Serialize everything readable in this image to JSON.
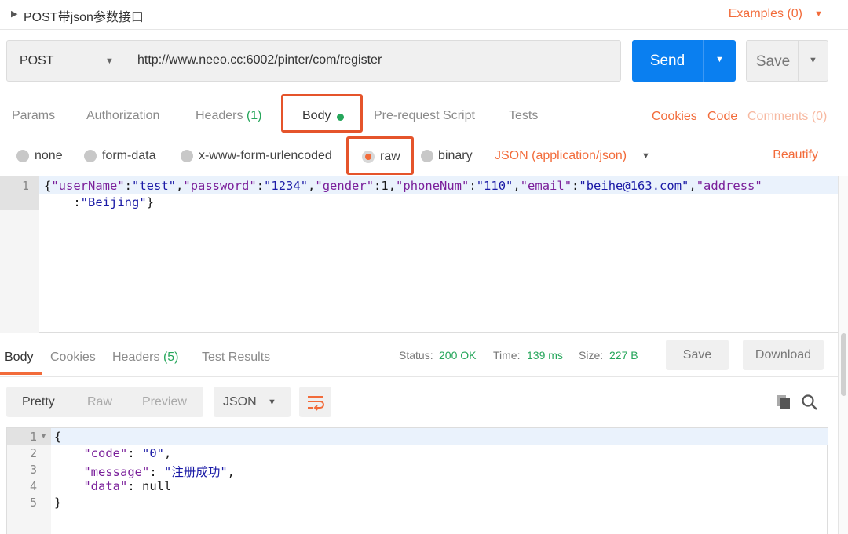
{
  "request": {
    "title": "POST带json参数接口",
    "examples_label": "Examples (0)",
    "method": "POST",
    "url": "http://www.neeo.cc:6002/pinter/com/register",
    "send_label": "Send",
    "save_label": "Save"
  },
  "request_tabs": {
    "params": "Params",
    "authorization": "Authorization",
    "headers": "Headers",
    "headers_count": "(1)",
    "body": "Body",
    "prerequest": "Pre-request Script",
    "tests": "Tests",
    "cookies": "Cookies",
    "code": "Code",
    "comments": "Comments (0)"
  },
  "body_types": {
    "none": "none",
    "form_data": "form-data",
    "urlencoded": "x-www-form-urlencoded",
    "raw": "raw",
    "binary": "binary",
    "selected": "raw",
    "content_type": "JSON (application/json)",
    "beautify": "Beautify"
  },
  "request_editor": {
    "line_number": "1",
    "line1": {
      "t1": "{",
      "t2": "\"userName\"",
      "t3": ":",
      "t4": "\"test\"",
      "t5": ",",
      "t6": "\"password\"",
      "t7": ":",
      "t8": "\"1234\"",
      "t9": ",",
      "t10": "\"gender\"",
      "t11": ":1,",
      "t12": "\"phoneNum\"",
      "t13": ":",
      "t14": "\"110\"",
      "t15": ",",
      "t16": "\"email\"",
      "t17": ":",
      "t18": "\"beihe@163.com\"",
      "t19": ",",
      "t20": "\"address\""
    },
    "line2": {
      "t1": "    :",
      "t2": "\"Beijing\"",
      "t3": "}"
    }
  },
  "response": {
    "tabs": {
      "body": "Body",
      "cookies": "Cookies",
      "headers": "Headers",
      "headers_count": "(5)",
      "test_results": "Test Results"
    },
    "status_label": "Status:",
    "status_value": "200 OK",
    "time_label": "Time:",
    "time_value": "139 ms",
    "size_label": "Size:",
    "size_value": "227 B",
    "save_label": "Save",
    "download_label": "Download",
    "view_tabs": {
      "pretty": "Pretty",
      "raw": "Raw",
      "preview": "Preview",
      "selected": "Pretty"
    },
    "format": "JSON",
    "line_numbers": [
      "1",
      "2",
      "3",
      "4",
      "5"
    ],
    "lines": {
      "l1": "{",
      "l2_key": "\"code\"",
      "l2_sep": ": ",
      "l2_val": "\"0\"",
      "l2_end": ",",
      "l3_key": "\"message\"",
      "l3_sep": ": ",
      "l3_val": "\"注册成功\"",
      "l3_end": ",",
      "l4_key": "\"data\"",
      "l4_sep": ": ",
      "l4_val": "null",
      "l5": "}"
    }
  },
  "icons": {
    "title_caret": "caret-right-icon",
    "dropdown": "caret-down-icon",
    "wrap": "wrap-lines-icon",
    "copy": "copy-icon",
    "search": "search-icon"
  },
  "colors": {
    "accent": "#f26b3a",
    "send": "#0a7ff0",
    "success": "#26a65b",
    "highlight_box": "#e5542b"
  }
}
